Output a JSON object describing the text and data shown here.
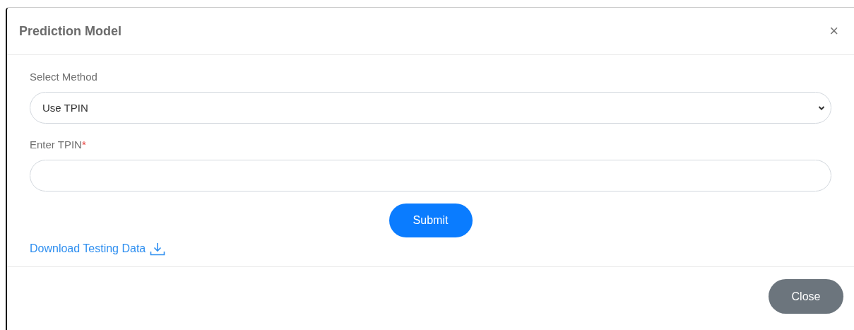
{
  "dialog": {
    "title": "Prediction Model",
    "close_icon": "×"
  },
  "fields": [
    {
      "kind": "select",
      "label": "Select Method",
      "value": "Use TPIN"
    },
    {
      "kind": "input",
      "label": "Enter TPIN",
      "required_mark": "*"
    }
  ],
  "submit_button": "Submit",
  "download_link": "Download Testing Data",
  "footer_buttons": [
    "Close"
  ]
}
